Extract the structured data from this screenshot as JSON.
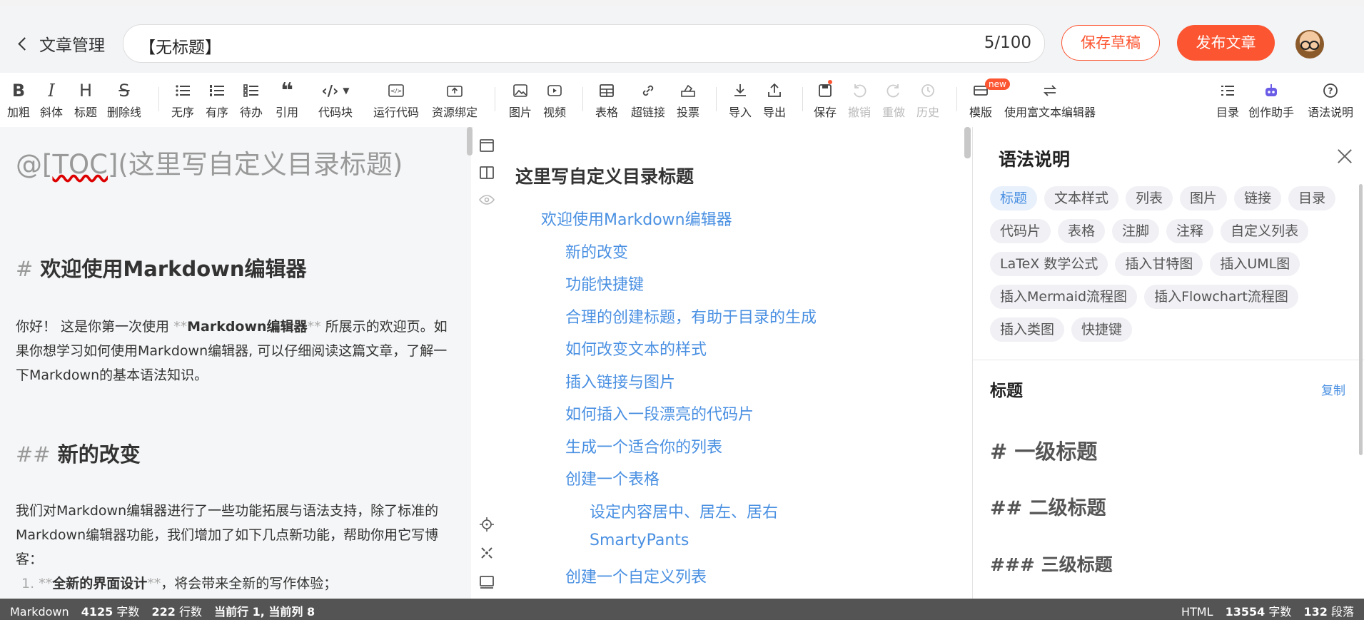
{
  "header": {
    "back_label": "文章管理",
    "title": "【无标题】",
    "title_count": "5/100",
    "save_draft": "保存草稿",
    "publish": "发布文章"
  },
  "toolbar": {
    "bold": "加粗",
    "italic": "斜体",
    "heading": "标题",
    "strike": "删除线",
    "unordered": "无序",
    "ordered": "有序",
    "todo": "待办",
    "quote": "引用",
    "codeblock": "代码块",
    "run_code": "运行代码",
    "resource": "资源绑定",
    "image": "图片",
    "video": "视频",
    "table": "表格",
    "link": "超链接",
    "vote": "投票",
    "import": "导入",
    "export": "导出",
    "save": "保存",
    "undo": "撤销",
    "redo": "重做",
    "history": "历史",
    "template": "模版",
    "template_badge": "new",
    "rich_editor": "使用富文本编辑器",
    "toc": "目录",
    "assistant": "创作助手",
    "syntax": "语法说明"
  },
  "editor": {
    "toc_line_prefix": "@[",
    "toc_line_toc": "TOC",
    "toc_line_rest": "](这里写自定义目录标题)",
    "h1_mark": "#",
    "h1_text": "欢迎使用Markdown编辑器",
    "p1_a": "你好！ 这是你第一次使用 ",
    "p1_mk1": "**",
    "p1_bold": "Markdown编辑器",
    "p1_mk2": "**",
    "p1_b": " 所展示的欢迎页。如果你想学习如何使用Markdown编辑器, 可以仔细阅读这篇文章，了解一下Markdown的基本语法知识。",
    "h2_mark": "##",
    "h2_text": "新的改变",
    "p2": "我们对Markdown编辑器进行了一些功能拓展与语法支持，除了标准的Markdown编辑器功能，我们增加了如下几点新功能，帮助你用它写博客：",
    "li1_num": "1.",
    "li1_mk1": "**",
    "li1_bold": "全新的界面设计",
    "li1_mk2": "**",
    "li1_rest": "，将会带来全新的写作体验；"
  },
  "preview": {
    "title": "这里写自定义目录标题",
    "toc": [
      {
        "text": "欢迎使用Markdown编辑器",
        "level": 1
      },
      {
        "text": "新的改变",
        "level": 2
      },
      {
        "text": "功能快捷键",
        "level": 2
      },
      {
        "text": "合理的创建标题，有助于目录的生成",
        "level": 2
      },
      {
        "text": "如何改变文本的样式",
        "level": 2
      },
      {
        "text": "插入链接与图片",
        "level": 2
      },
      {
        "text": "如何插入一段漂亮的代码片",
        "level": 2
      },
      {
        "text": "生成一个适合你的列表",
        "level": 2
      },
      {
        "text": "创建一个表格",
        "level": 2
      },
      {
        "text": "设定内容居中、居左、居右",
        "level": 3
      },
      {
        "text": "SmartyPants",
        "level": 3
      },
      {
        "text": "创建一个自定义列表",
        "level": 2
      }
    ]
  },
  "panel": {
    "title": "语法说明",
    "tags": [
      "标题",
      "文本样式",
      "列表",
      "图片",
      "链接",
      "目录",
      "代码片",
      "表格",
      "注脚",
      "注释",
      "自定义列表",
      "LaTeX 数学公式",
      "插入甘特图",
      "插入UML图",
      "插入Mermaid流程图",
      "插入Flowchart流程图",
      "插入类图",
      "快捷键"
    ],
    "active_tag": "标题",
    "section_title": "标题",
    "copy": "复制",
    "h1_mark": "#",
    "h1_text": "一级标题",
    "h2_mark": "##",
    "h2_text": "二级标题",
    "h3_mark": "###",
    "h3_text": "三级标题"
  },
  "status": {
    "mode": "Markdown",
    "chars_num": "4125",
    "chars_label": "字数",
    "lines_num": "222",
    "lines_label": "行数",
    "cursor": "当前行 1, 当前列 8",
    "right_mode": "HTML",
    "right_chars_num": "13554",
    "right_chars_label": "字数",
    "paras_num": "132",
    "paras_label": "段落"
  },
  "colors": {
    "accent": "#fc5531",
    "link": "#4a90e2",
    "status_bg": "#545454"
  }
}
